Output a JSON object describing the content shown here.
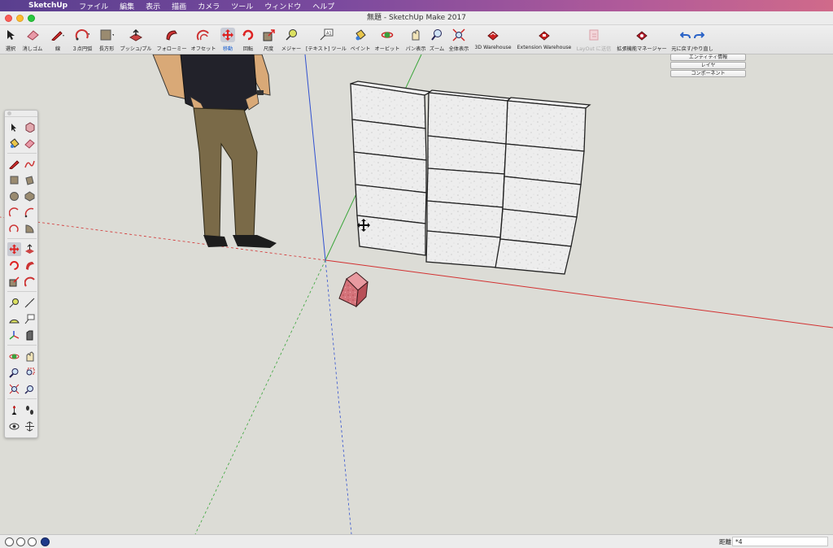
{
  "menubar": {
    "app": "SketchUp",
    "items": [
      "ファイル",
      "編集",
      "表示",
      "描画",
      "カメラ",
      "ツール",
      "ウィンドウ",
      "ヘルプ"
    ]
  },
  "window": {
    "title": "無題 - SketchUp Make 2017"
  },
  "toolbar": {
    "tools": [
      {
        "label": "選択",
        "icon": "select-arrow-icon"
      },
      {
        "label": "消しゴム",
        "icon": "eraser-icon"
      },
      {
        "label": "線",
        "icon": "pencil-icon"
      },
      {
        "label": "３点円弧",
        "icon": "arc-icon"
      },
      {
        "label": "長方形",
        "icon": "rectangle-icon"
      },
      {
        "label": "プッシュ/プル",
        "icon": "push-pull-icon"
      },
      {
        "label": "フォローミー",
        "icon": "follow-me-icon"
      },
      {
        "label": "オフセット",
        "icon": "offset-icon"
      },
      {
        "label": "移動",
        "icon": "move-icon"
      },
      {
        "label": "回転",
        "icon": "rotate-icon"
      },
      {
        "label": "尺度",
        "icon": "scale-icon"
      },
      {
        "label": "メジャー",
        "icon": "tape-measure-icon"
      },
      {
        "label": "[テキスト] ツール",
        "icon": "text-tool-icon"
      },
      {
        "label": "ペイント",
        "icon": "paint-bucket-icon"
      },
      {
        "label": "オービット",
        "icon": "orbit-icon"
      },
      {
        "label": "パン表示",
        "icon": "pan-icon"
      },
      {
        "label": "ズーム",
        "icon": "zoom-icon"
      },
      {
        "label": "全体表示",
        "icon": "zoom-extents-icon"
      },
      {
        "label": "3D Warehouse",
        "icon": "3d-warehouse-icon"
      },
      {
        "label": "Extension Warehouse",
        "icon": "extension-warehouse-icon"
      },
      {
        "label": "LayOut に送信",
        "icon": "send-to-layout-icon"
      },
      {
        "label": "拡張機能マネージャー",
        "icon": "extension-manager-icon"
      },
      {
        "label": "元に戻す/やり直し",
        "icon": "undo-redo-icon"
      }
    ],
    "active_tool": "移動"
  },
  "panels": {
    "buttons": [
      "エンティティ情報",
      "レイヤ",
      "コンポーネント"
    ]
  },
  "status": {
    "measurement_label": "距離",
    "measurement_value": "*4"
  },
  "colors": {
    "viewport_bg": "#dcdcd6",
    "axis_red": "#d23030",
    "axis_green": "#3aa53a",
    "axis_blue": "#3050d0",
    "accent": "#1a5fd0"
  }
}
